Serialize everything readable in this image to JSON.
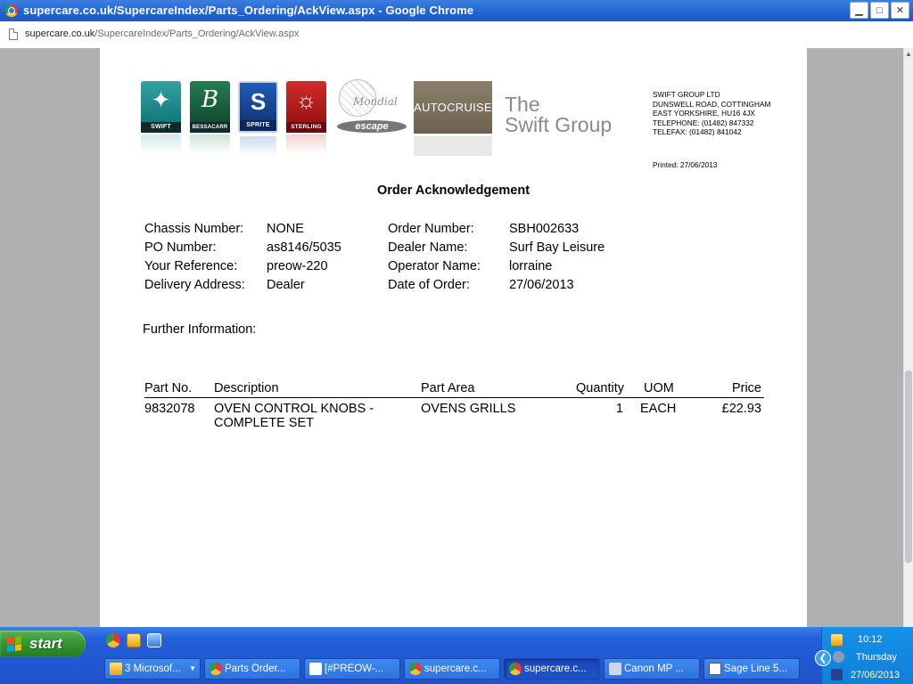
{
  "window": {
    "title": "supercare.co.uk/SupercareIndex/Parts_Ordering/AckView.aspx - Google Chrome",
    "address_domain": "supercare.co.uk",
    "address_path": "/SupercareIndex/Parts_Ordering/AckView.aspx",
    "minimize": "▁",
    "maximize": "□",
    "close": "✕"
  },
  "logos": {
    "swift": "SWIFT",
    "bessacarr": "BESSACARR",
    "sprite": "SPRITE",
    "sterling": "STERLING",
    "mondial": "Mondial",
    "escape": "escape",
    "autocruise": "AUTOCRUISE",
    "swift_group_line1": "The",
    "swift_group_line2": "Swift Group"
  },
  "company": {
    "name": "SWIFT GROUP LTD",
    "address1": "DUNSWELL ROAD, COTTINGHAM",
    "address2": "EAST YORKSHIRE, HU16 4JX",
    "telephone": "TELEPHONE: (01482) 847332",
    "telefax": "TELEFAX: (01482) 841042",
    "printed": "Printed: 27/06/2013"
  },
  "document": {
    "title": "Order Acknowledgement",
    "further_info_label": "Further Information:"
  },
  "order_info": {
    "left_labels": [
      "Chassis Number:",
      "PO Number:",
      "Your Reference:",
      "Delivery Address:"
    ],
    "left_values": [
      "NONE",
      "as8146/5035",
      "preow-220",
      "Dealer"
    ],
    "right_labels": [
      "Order Number:",
      "Dealer Name:",
      "Operator Name:",
      "Date of Order:"
    ],
    "right_values": [
      "SBH002633",
      "Surf Bay Leisure",
      "lorraine",
      "27/06/2013"
    ]
  },
  "table": {
    "headers": {
      "part_no": "Part No.",
      "description": "Description",
      "part_area": "Part Area",
      "quantity": "Quantity",
      "uom": "UOM",
      "price": "Price"
    },
    "rows": [
      {
        "part_no": "9832078",
        "description": "OVEN CONTROL KNOBS - COMPLETE SET",
        "part_area": "OVENS GRILLS",
        "quantity": "1",
        "uom": "EACH",
        "price": "£22.93"
      }
    ]
  },
  "taskbar": {
    "start": "start",
    "tasks": [
      {
        "label": "3 Microsof...",
        "icon": "outlook-icon"
      },
      {
        "label": "Parts Order...",
        "icon": "chrome-icon"
      },
      {
        "label": "[#PREOW-...",
        "icon": "jira-icon"
      },
      {
        "label": "supercare.c...",
        "icon": "chrome-icon"
      },
      {
        "label": "supercare.c...",
        "icon": "chrome-icon"
      },
      {
        "label": "Canon MP ...",
        "icon": "printer-icon"
      },
      {
        "label": "Sage Line 5...",
        "icon": "sage-icon"
      }
    ],
    "clock": "10:12",
    "day": "Thursday",
    "date": "27/06/2013"
  }
}
